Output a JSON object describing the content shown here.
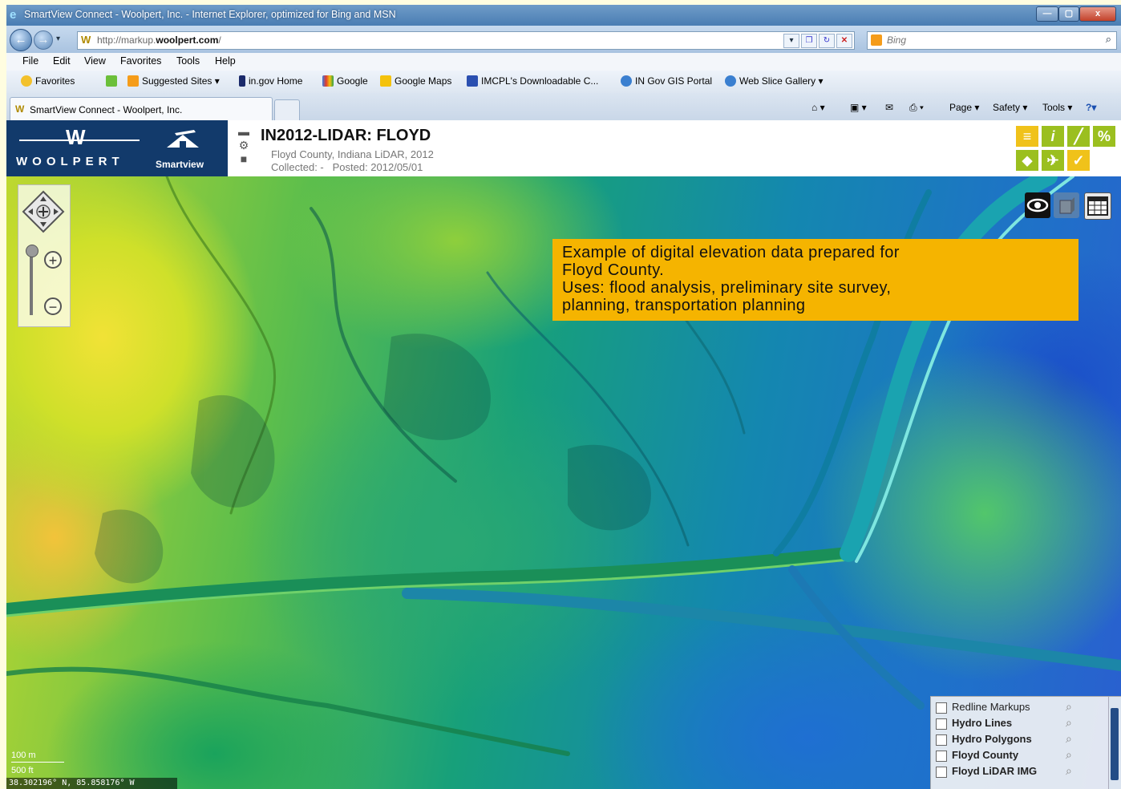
{
  "window": {
    "title": "SmartView Connect - Woolpert, Inc. - Internet Explorer, optimized for Bing and MSN",
    "controls": [
      "—",
      "▢",
      "x"
    ]
  },
  "address": {
    "url": "http://markup.woolpert.com/",
    "url_plain": "http://markup.",
    "url_bold": "woolpert.com",
    "url_tail": "/",
    "search_placeholder": "Bing"
  },
  "menu": [
    "File",
    "Edit",
    "View",
    "Favorites",
    "Tools",
    "Help"
  ],
  "favorites": {
    "label": "Favorites",
    "items": [
      "Suggested Sites ▾",
      "in.gov Home",
      "Google",
      "Google Maps",
      "IMCPL's Downloadable C...",
      "IN Gov GIS Portal",
      "Web Slice Gallery ▾"
    ]
  },
  "tab": {
    "title": "SmartView Connect - Woolpert, Inc."
  },
  "commands": {
    "page": "Page ▾",
    "safety": "Safety ▾",
    "tools": "Tools ▾",
    "help": "?▾"
  },
  "app": {
    "logo_name": "WOOLPERT",
    "logo_sub": "Smartview",
    "dataset_title": "IN2012-LIDAR: FLOYD",
    "dataset_desc": "Floyd County, Indiana LiDAR, 2012",
    "collected": "Collected: -",
    "posted": "Posted: 2012/05/01"
  },
  "callout": {
    "lines": [
      "Example of digital elevation data prepared for",
      "Floyd County.",
      "Uses: flood analysis, preliminary site survey,",
      "planning, transportation planning"
    ]
  },
  "layers": [
    "Redline Markups",
    "Hydro Lines",
    "Hydro Polygons",
    "Floyd County",
    "Floyd LiDAR IMG"
  ],
  "scale": {
    "metric": "100 m",
    "imperial": "500 ft"
  },
  "coords": "38.302196° N, 85.858176° W",
  "colors": {
    "header_blue": "#123a6b",
    "callout": "#f5b400",
    "tool_yellow": "#f0c21a",
    "tool_green": "#9bbf1f"
  }
}
